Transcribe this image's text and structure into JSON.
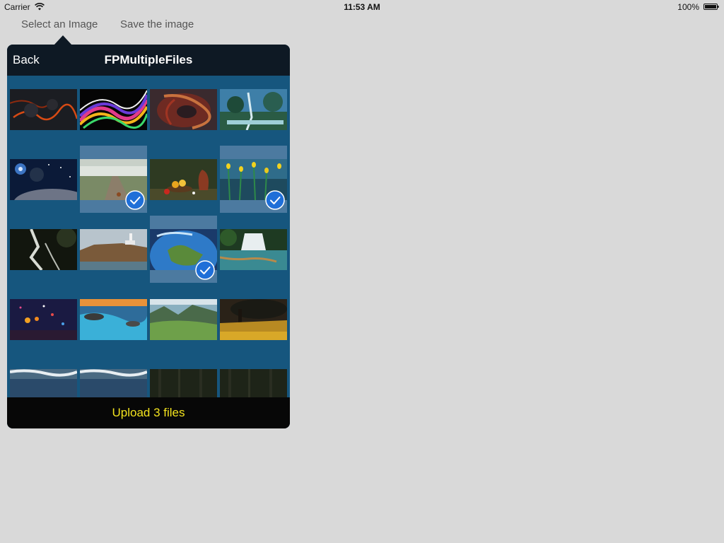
{
  "status_bar": {
    "carrier": "Carrier",
    "time": "11:53 AM",
    "battery": "100%"
  },
  "toolbar": {
    "select_label": "Select an Image",
    "save_label": "Save the image"
  },
  "popover": {
    "back_label": "Back",
    "title": "FPMultipleFiles",
    "upload_label": "Upload 3 files",
    "upload_color": "#f2e21e"
  },
  "grid": {
    "selected_count": 3,
    "items": [
      {
        "name": "lava-rock",
        "selected": false
      },
      {
        "name": "colorful-smoke-waves",
        "selected": false
      },
      {
        "name": "abstract-red-swirl",
        "selected": false
      },
      {
        "name": "fantasy-waterfall-valley",
        "selected": false
      },
      {
        "name": "space-galaxy-planets",
        "selected": false
      },
      {
        "name": "foggy-country-road",
        "selected": true
      },
      {
        "name": "fruit-still-life",
        "selected": false
      },
      {
        "name": "blue-tulips",
        "selected": true
      },
      {
        "name": "dark-waterfall-cliff",
        "selected": false
      },
      {
        "name": "lighthouse-coast",
        "selected": false
      },
      {
        "name": "earth-europe-globe",
        "selected": true
      },
      {
        "name": "waterfall-pool",
        "selected": false
      },
      {
        "name": "night-lanterns-bokeh",
        "selected": false
      },
      {
        "name": "ocean-rocks-sunset",
        "selected": false
      },
      {
        "name": "green-mountain-valley",
        "selected": false
      },
      {
        "name": "golden-tree-field",
        "selected": false
      },
      {
        "name": "stormy-sea-clouds",
        "selected": false
      },
      {
        "name": "stormy-sea-clouds-2",
        "selected": false
      },
      {
        "name": "dark-forest",
        "selected": false
      },
      {
        "name": "dark-forest-2",
        "selected": false
      }
    ]
  }
}
